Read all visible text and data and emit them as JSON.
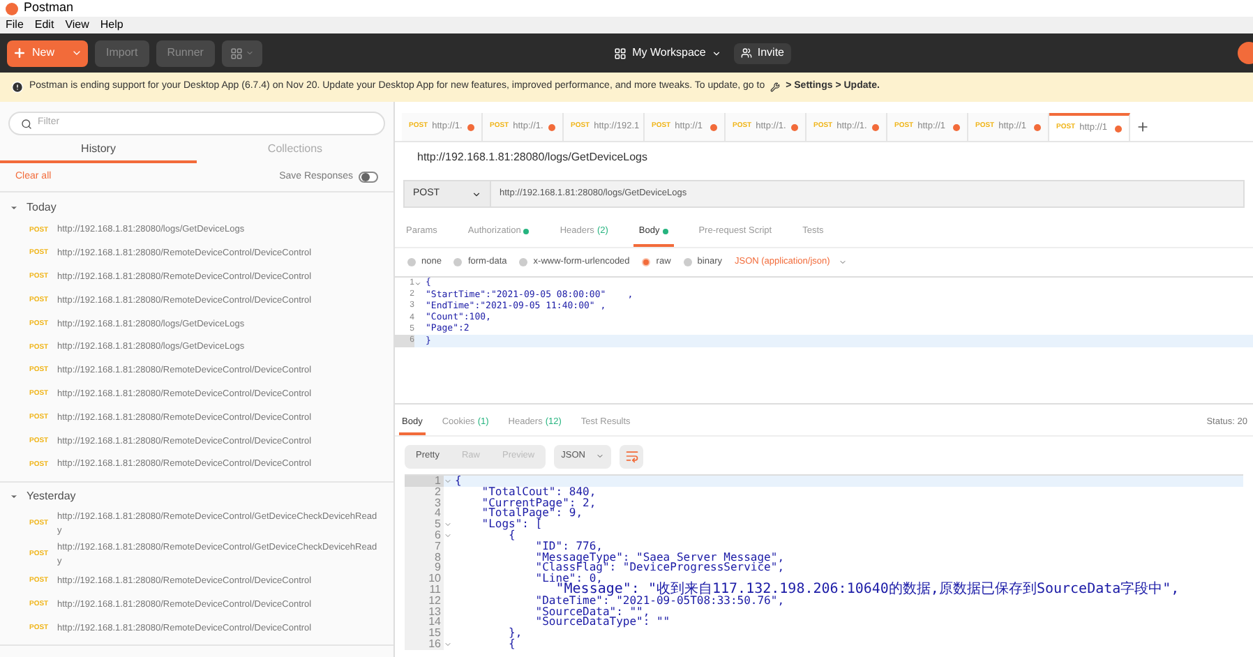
{
  "window": {
    "title": "Postman"
  },
  "menu": [
    "File",
    "Edit",
    "View",
    "Help"
  ],
  "toolbar": {
    "new_label": "New",
    "buttons": [
      "Import",
      "Runner"
    ],
    "workspace": "My Workspace",
    "invite": "Invite"
  },
  "banner": {
    "text": "Postman is ending support for your Desktop App (6.7.4) on Nov 20. Update your Desktop App for new features, improved performance, and more tweaks. To update, go to",
    "path": "> Settings > Update."
  },
  "sidebar": {
    "filter_placeholder": "Filter",
    "tabs": [
      {
        "label": "History",
        "selected": true
      },
      {
        "label": "Collections",
        "selected": false
      }
    ],
    "clear_all": "Clear all",
    "save_responses": {
      "label": "Save Responses",
      "on": false
    },
    "groups": [
      {
        "label": "Today",
        "expanded": true,
        "items": [
          {
            "method": "POST",
            "url": "http://192.168.1.81:28080/logs/GetDeviceLogs"
          },
          {
            "method": "POST",
            "url": "http://192.168.1.81:28080/RemoteDeviceControl/DeviceControl"
          },
          {
            "method": "POST",
            "url": "http://192.168.1.81:28080/RemoteDeviceControl/DeviceControl"
          },
          {
            "method": "POST",
            "url": "http://192.168.1.81:28080/RemoteDeviceControl/DeviceControl"
          },
          {
            "method": "POST",
            "url": "http://192.168.1.81:28080/logs/GetDeviceLogs"
          },
          {
            "method": "POST",
            "url": "http://192.168.1.81:28080/logs/GetDeviceLogs"
          },
          {
            "method": "POST",
            "url": "http://192.168.1.81:28080/RemoteDeviceControl/DeviceControl"
          },
          {
            "method": "POST",
            "url": "http://192.168.1.81:28080/RemoteDeviceControl/DeviceControl"
          },
          {
            "method": "POST",
            "url": "http://192.168.1.81:28080/RemoteDeviceControl/DeviceControl"
          },
          {
            "method": "POST",
            "url": "http://192.168.1.81:28080/RemoteDeviceControl/DeviceControl"
          },
          {
            "method": "POST",
            "url": "http://192.168.1.81:28080/RemoteDeviceControl/DeviceControl"
          }
        ]
      },
      {
        "label": "Yesterday",
        "expanded": true,
        "items": [
          {
            "method": "POST",
            "url": "http://192.168.1.81:28080/RemoteDeviceControl/GetDeviceCheckDevicehReady"
          },
          {
            "method": "POST",
            "url": "http://192.168.1.81:28080/RemoteDeviceControl/GetDeviceCheckDevicehReady"
          },
          {
            "method": "POST",
            "url": "http://192.168.1.81:28080/RemoteDeviceControl/DeviceControl"
          },
          {
            "method": "POST",
            "url": "http://192.168.1.81:28080/RemoteDeviceControl/DeviceControl"
          },
          {
            "method": "POST",
            "url": "http://192.168.1.81:28080/RemoteDeviceControl/DeviceControl"
          }
        ]
      }
    ]
  },
  "request_tabs": [
    {
      "method": "POST",
      "url": "http://1.",
      "selected": false
    },
    {
      "method": "POST",
      "url": "http://1.",
      "selected": false
    },
    {
      "method": "POST",
      "url": "http://192.1",
      "selected": false
    },
    {
      "method": "POST",
      "url": "http://1",
      "selected": false
    },
    {
      "method": "POST",
      "url": "http://1.",
      "selected": false
    },
    {
      "method": "POST",
      "url": "http://1.",
      "selected": false
    },
    {
      "method": "POST",
      "url": "http://1",
      "selected": false
    },
    {
      "method": "POST",
      "url": "http://1",
      "selected": false
    },
    {
      "method": "POST",
      "url": "http://1",
      "selected": true
    }
  ],
  "request": {
    "title": "http://192.168.1.81:28080/logs/GetDeviceLogs",
    "method": "POST",
    "url": "http://192.168.1.81:28080/logs/GetDeviceLogs",
    "tabs": [
      {
        "label": "Params",
        "dot": false,
        "selected": false
      },
      {
        "label": "Authorization",
        "dot": true,
        "selected": false
      },
      {
        "label": "Headers",
        "count": "(2)",
        "dot": false,
        "selected": false
      },
      {
        "label": "Body",
        "dot": true,
        "selected": true
      },
      {
        "label": "Pre-request Script",
        "dot": false,
        "selected": false
      },
      {
        "label": "Tests",
        "dot": false,
        "selected": false
      }
    ],
    "body_types": [
      {
        "label": "none",
        "selected": false
      },
      {
        "label": "form-data",
        "selected": false
      },
      {
        "label": "x-www-form-urlencoded",
        "selected": false
      },
      {
        "label": "raw",
        "selected": true
      },
      {
        "label": "binary",
        "selected": false
      }
    ],
    "content_type": "JSON (application/json)",
    "code": [
      {
        "num": "1",
        "text": "{",
        "fold": true,
        "current": false
      },
      {
        "num": "2",
        "text": "\"StartTime\":\"2021-09-05 08:00:00\"    ,",
        "fold": false,
        "current": false
      },
      {
        "num": "3",
        "text": "\"EndTime\":\"2021-09-05 11:40:00\" ,",
        "fold": false,
        "current": false
      },
      {
        "num": "4",
        "text": "\"Count\":100,",
        "fold": false,
        "current": false
      },
      {
        "num": "5",
        "text": "\"Page\":2",
        "fold": false,
        "current": false
      },
      {
        "num": "6",
        "text": "}",
        "fold": false,
        "current": true
      }
    ]
  },
  "response": {
    "tabs": [
      {
        "label": "Body",
        "selected": true
      },
      {
        "label": "Cookies",
        "count": "(1)",
        "selected": false
      },
      {
        "label": "Headers",
        "count": "(12)",
        "selected": false
      },
      {
        "label": "Test Results",
        "selected": false
      }
    ],
    "status": "Status: 20",
    "views": [
      {
        "label": "Pretty",
        "selected": true
      },
      {
        "label": "Raw",
        "selected": false
      },
      {
        "label": "Preview",
        "selected": false
      }
    ],
    "format": "JSON",
    "code": [
      {
        "num": "1",
        "text": "{",
        "fold": true,
        "current": true
      },
      {
        "num": "2",
        "text": "    \"TotalCout\": 840,",
        "fold": false,
        "current": false
      },
      {
        "num": "3",
        "text": "    \"CurrentPage\": 2,",
        "fold": false,
        "current": false
      },
      {
        "num": "4",
        "text": "    \"TotalPage\": 9,",
        "fold": false,
        "current": false
      },
      {
        "num": "5",
        "text": "    \"Logs\": [",
        "fold": true,
        "current": false
      },
      {
        "num": "6",
        "text": "        {",
        "fold": true,
        "current": false
      },
      {
        "num": "7",
        "text": "            \"ID\": 776,",
        "fold": false,
        "current": false
      },
      {
        "num": "8",
        "text": "            \"MessageType\": \"Saea Server Message\",",
        "fold": false,
        "current": false
      },
      {
        "num": "9",
        "text": "            \"ClassFlag\": \"DeviceProgressService\",",
        "fold": false,
        "current": false
      },
      {
        "num": "10",
        "text": "            \"Line\": 0,",
        "fold": false,
        "current": false
      },
      {
        "num": "11",
        "text": "            \"Message\": \"收到来自117.132.198.206:10640的数据,原数据已保存到SourceData字段中\",",
        "fold": false,
        "current": false
      },
      {
        "num": "12",
        "text": "            \"DateTime\": \"2021-09-05T08:33:50.76\",",
        "fold": false,
        "current": false
      },
      {
        "num": "13",
        "text": "            \"SourceData\": \"\",",
        "fold": false,
        "current": false
      },
      {
        "num": "14",
        "text": "            \"SourceDataType\": \"\"",
        "fold": false,
        "current": false
      },
      {
        "num": "15",
        "text": "        },",
        "fold": false,
        "current": false
      },
      {
        "num": "16",
        "text": "        {",
        "fold": true,
        "current": false
      }
    ]
  }
}
